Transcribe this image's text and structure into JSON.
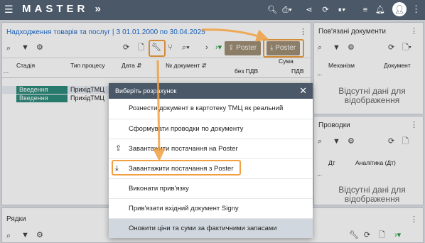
{
  "app": {
    "logo": "MASTER",
    "logo_suffix": "»"
  },
  "topbar_icons": [
    "search-icon",
    "print-icon",
    "share-icon",
    "refresh-icon",
    "pause-icon",
    "filter-settings-icon",
    "bell-icon",
    "user-avatar-icon",
    "more-icon"
  ],
  "main": {
    "title_prefix": "Надходження товарів та послуг | З ",
    "title_range": "01.01.2000 по 30.04.2025",
    "poster_btn_1": "Poster",
    "poster_btn_2": "Poster",
    "columns": {
      "stage": "Стадія",
      "process": "Тип процесу",
      "date": "Дата",
      "doc": "№ документ",
      "sum": "Сума",
      "no_vat": "без ПДВ",
      "vat": "ПДВ"
    },
    "rows": [
      {
        "status": "Введення",
        "process": "ПрихідТМЦ"
      },
      {
        "status": "Введення",
        "process": "ПрихідТМЦ"
      }
    ],
    "ellipsis": "..."
  },
  "related": {
    "title": "Пов'язані документи",
    "col_mechanism": "Механізм",
    "col_document": "Документ",
    "empty_line1": "Відсутні дані для",
    "empty_line2": "відображення"
  },
  "postings": {
    "title": "Проводки",
    "col_dt": "Дт",
    "col_analytics": "Аналітика (Дт)",
    "empty_line1": "Відсутні дані для",
    "empty_line2": "відображення"
  },
  "lines": {
    "title": "Рядки"
  },
  "dialog": {
    "title": "Виберіть розрахунок",
    "items": [
      "Рознести документ в картотеку ТМЦ як реальний",
      "Сформувати проводки по документу",
      "Завантажити постачання на Poster",
      "Завантажити постачання з Poster",
      "Виконати прив'язку",
      "Прив'язати вхідний документ Signy",
      "Оновити ціни та суми за фактичними запасами"
    ]
  },
  "colors": {
    "topbar": "#4a5868",
    "status": "#2e8b7d",
    "poster_btn": "#a08f76",
    "highlight": "#f0a040",
    "link": "#1f6fd1"
  }
}
